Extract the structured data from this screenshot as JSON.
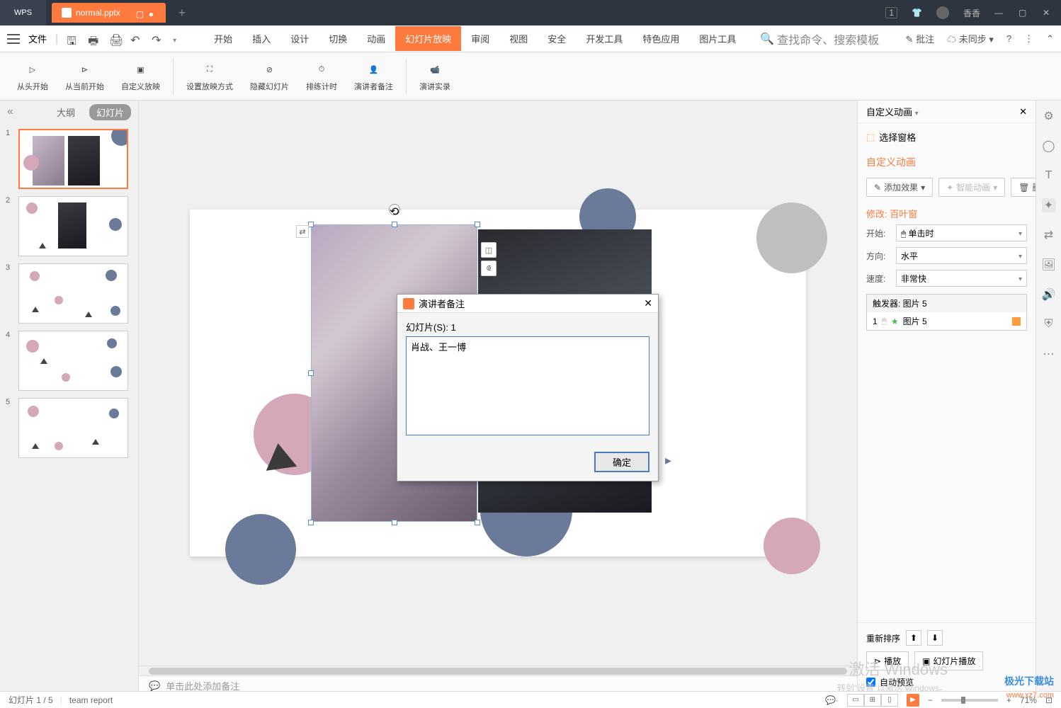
{
  "titlebar": {
    "app": "WPS",
    "tab_name": "normal.pptx",
    "new_tab": "+",
    "badge": "1",
    "user": "香香"
  },
  "menubar": {
    "file": "文件",
    "tabs": [
      "开始",
      "插入",
      "设计",
      "切换",
      "动画",
      "幻灯片放映",
      "审阅",
      "视图",
      "安全",
      "开发工具",
      "特色应用",
      "图片工具"
    ],
    "active_tab_index": 5,
    "search_placeholder": "查找命令、搜索模板",
    "comment": "批注",
    "sync": "未同步"
  },
  "ribbon": {
    "items": [
      "从头开始",
      "从当前开始",
      "自定义放映",
      "设置放映方式",
      "隐藏幻灯片",
      "排练计时",
      "演讲者备注",
      "演讲实录"
    ]
  },
  "thumb": {
    "outline": "大纲",
    "slides": "幻灯片",
    "count": 5
  },
  "dialog": {
    "title": "演讲者备注",
    "slide_label": "幻灯片(S): 1",
    "text": "肖战、王一博",
    "ok": "确定"
  },
  "right": {
    "header": "自定义动画",
    "select_pane": "选择窗格",
    "anim_title": "自定义动画",
    "add_effect": "添加效果",
    "smart_anim": "智能动画",
    "delete": "删除",
    "modify": "修改: 百叶窗",
    "start_lbl": "开始:",
    "start_val": "单击时",
    "dir_lbl": "方向:",
    "dir_val": "水平",
    "speed_lbl": "速度:",
    "speed_val": "非常快",
    "trigger_head": "触发器: 图片 5",
    "trigger_item_num": "1",
    "trigger_item": "图片 5",
    "reorder": "重新排序",
    "play": "播放",
    "slideshow": "幻灯片播放",
    "auto_preview": "自动预览"
  },
  "notes": {
    "placeholder": "单击此处添加备注"
  },
  "status": {
    "slide": "幻灯片 1 / 5",
    "doc": "team report",
    "zoom": "71%"
  },
  "watermark": {
    "l1": "激活 Windows",
    "l2": "转到“设置”以激活 Windows。",
    "logo1": "极光下载站",
    "logo2": "www.xz7.com"
  }
}
